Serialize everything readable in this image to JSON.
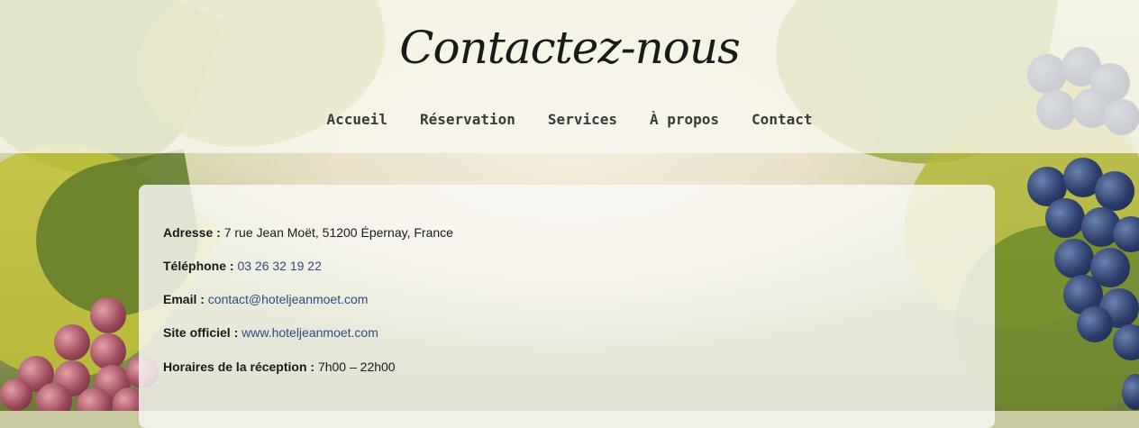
{
  "header": {
    "title": "Contactez-nous"
  },
  "nav": {
    "items": [
      "Accueil",
      "Réservation",
      "Services",
      "À propos",
      "Contact"
    ]
  },
  "contact": {
    "address_label": "Adresse :",
    "address_value": "7 rue Jean Moët, 51200 Épernay, France",
    "phone_label": "Téléphone :",
    "phone_value": "03 26 32 19 22",
    "email_label": "Email :",
    "email_value": "contact@hoteljeanmoet.com",
    "site_label": "Site officiel :",
    "site_value": "www.hoteljeanmoet.com",
    "hours_label": "Horaires de la réception :",
    "hours_value": "7h00 – 22h00"
  },
  "colors": {
    "link": "#2c4f7c",
    "nav_text": "#3a3a3a"
  }
}
